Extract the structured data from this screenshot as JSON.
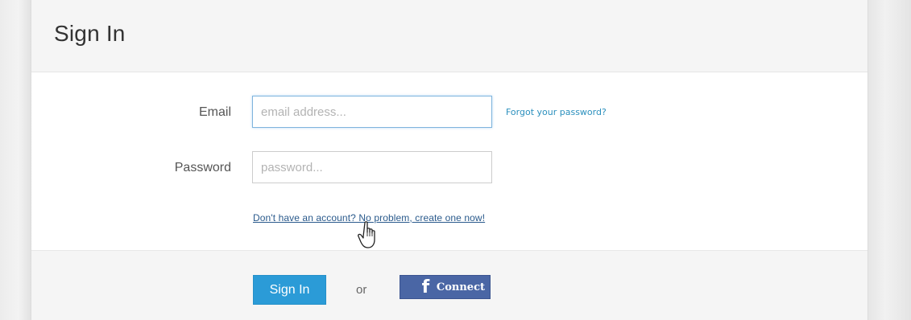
{
  "form": {
    "title": "Sign In",
    "email_label": "Email",
    "email_placeholder": "email address...",
    "email_value": "",
    "forgot_password": "Forgot your password?",
    "password_label": "Password",
    "password_placeholder": "password...",
    "password_value": "",
    "create_account": "Don't have an account? No problem, create one now!"
  },
  "footer": {
    "signin_label": "Sign In",
    "or_label": "or",
    "facebook_icon": "f",
    "facebook_label": "Connect"
  },
  "cursor": {
    "icon": "hand-pointer-icon"
  },
  "colors": {
    "primary": "#2b9bd7",
    "facebook": "#4a66a5",
    "link": "#2a8fbd",
    "header_bg": "#f5f5f5"
  }
}
